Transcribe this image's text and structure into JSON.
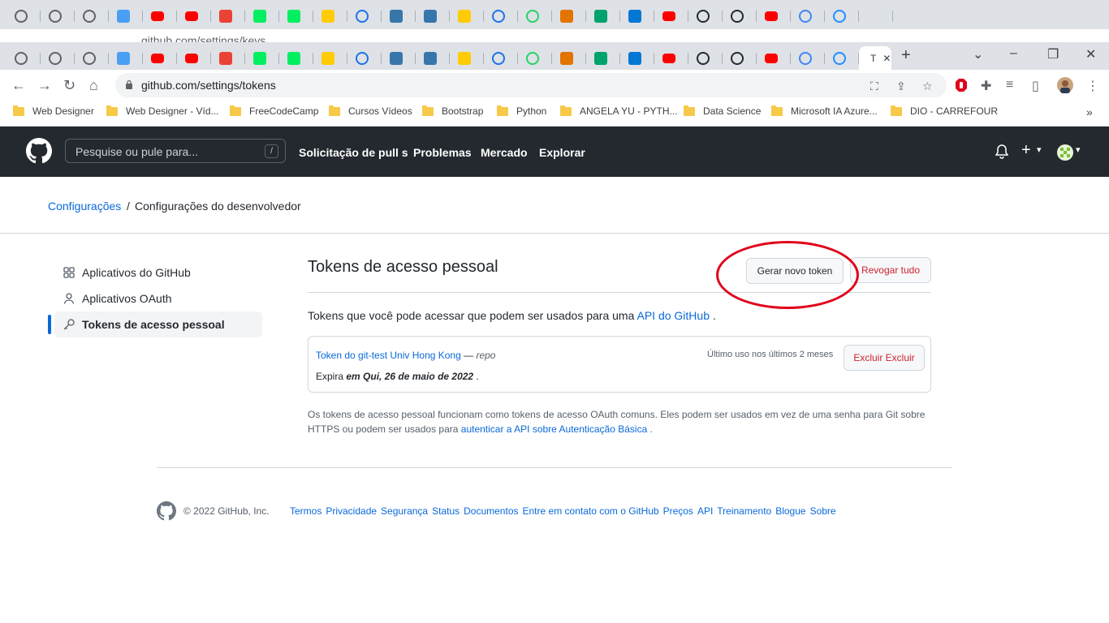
{
  "browser": {
    "ghost_url": "github.com/settings/keys",
    "tabs": [
      {
        "icon": "chrome-icon",
        "color": "#5f6368"
      },
      {
        "icon": "globe-icon",
        "color": "#5f6368"
      },
      {
        "icon": "globe-icon",
        "color": "#5f6368"
      },
      {
        "icon": "cloud-icon",
        "color": "#4a9ff5"
      },
      {
        "icon": "youtube-icon",
        "color": "#ff0000"
      },
      {
        "icon": "youtube-icon",
        "color": "#ff0000"
      },
      {
        "icon": "gmail-icon",
        "color": "#ea4335"
      },
      {
        "icon": "datacamp-icon",
        "color": "#03ef62"
      },
      {
        "icon": "datacamp-icon",
        "color": "#03ef62"
      },
      {
        "icon": "michigan-icon",
        "color": "#ffcb05"
      },
      {
        "icon": "c-icon",
        "color": "#1a73e8"
      },
      {
        "icon": "python-icon",
        "color": "#3776ab"
      },
      {
        "icon": "python-icon",
        "color": "#3776ab"
      },
      {
        "icon": "michigan-icon",
        "color": "#ffcb05"
      },
      {
        "icon": "c-icon",
        "color": "#1a73e8"
      },
      {
        "icon": "whatsapp-icon",
        "color": "#25d366"
      },
      {
        "icon": "image-icon",
        "color": "#e37400"
      },
      {
        "icon": "green-app-icon",
        "color": "#00a36c"
      },
      {
        "icon": "azure-icon",
        "color": "#0078d4"
      },
      {
        "icon": "youtube-icon",
        "color": "#ff0000"
      },
      {
        "icon": "github-icon",
        "color": "#24292f"
      },
      {
        "icon": "github-icon",
        "color": "#24292f"
      },
      {
        "icon": "youtube-icon",
        "color": "#ff0000"
      },
      {
        "icon": "google-icon",
        "color": "#4285f4"
      },
      {
        "icon": "edge-icon",
        "color": "#1f8fff"
      },
      {
        "icon": "tab-active",
        "color": "#5f6368"
      }
    ],
    "active_tab_letter": "T",
    "url": "github.com/settings/tokens",
    "bookmarks": [
      {
        "label": "Web Designer"
      },
      {
        "label": "Web Designer - Víd..."
      },
      {
        "label": "FreeCodeCamp"
      },
      {
        "label": "Cursos Vídeos"
      },
      {
        "label": "Bootstrap"
      },
      {
        "label": "Python"
      },
      {
        "label": "ANGELA YU - PYTH..."
      },
      {
        "label": "Data Science"
      },
      {
        "label": "Microsoft IA Azure..."
      },
      {
        "label": "DIO - CARREFOUR"
      }
    ],
    "bookmarks_more": "»"
  },
  "github": {
    "search_placeholder": "Pesquise ou pule para...",
    "search_key": "/",
    "nav": [
      "Solicitação de pull s",
      "Problemas",
      "Mercado",
      "Explorar"
    ],
    "plus": "+",
    "caret": "▾"
  },
  "breadcrumb": {
    "parent": "Configurações",
    "separator": "/",
    "current": "Configurações do desenvolvedor"
  },
  "sidebar": {
    "items": [
      {
        "label": "Aplicativos do GitHub",
        "icon": "apps-grid-icon"
      },
      {
        "label": "Aplicativos OAuth",
        "icon": "person-icon"
      },
      {
        "label": "Tokens de acesso pessoal",
        "icon": "key-icon",
        "selected": true
      }
    ]
  },
  "main": {
    "title": "Tokens de acesso pessoal",
    "generate_button": "Gerar novo token",
    "revoke_button": "Revogar tudo",
    "intro_text": "Tokens que você pode acessar que podem ser usados para uma ",
    "intro_link": "API do GitHub",
    "intro_end": " .",
    "token": {
      "name": "Token do git-test Univ Hong Kong",
      "dash": " — ",
      "scope": "repo",
      "last_used": "Último uso nos últimos 2 meses",
      "delete_button": "Excluir Excluir",
      "expires_label": "Expira ",
      "expires_value": "em Qui, 26 de maio de 2022",
      "expires_end": " ."
    },
    "note_text": "Os tokens de acesso pessoal funcionam como tokens de acesso OAuth comuns. Eles podem ser usados em vez de uma senha para Git sobre HTTPS ou podem ser usados para ",
    "note_link": "autenticar a API sobre Autenticação Básica",
    "note_end": " ."
  },
  "footer": {
    "copyright": "© 2022 GitHub, Inc.",
    "links": [
      "Termos",
      "Privacidade",
      "Segurança",
      "Status",
      "Documentos",
      "Entre em contato com o GitHub",
      "Preços",
      "API",
      "Treinamento",
      "Blogue",
      "Sobre"
    ]
  },
  "colors": {
    "header_bg": "#24292f",
    "link": "#0969da",
    "danger": "#cf222e",
    "highlight_ring": "#e0001b"
  }
}
